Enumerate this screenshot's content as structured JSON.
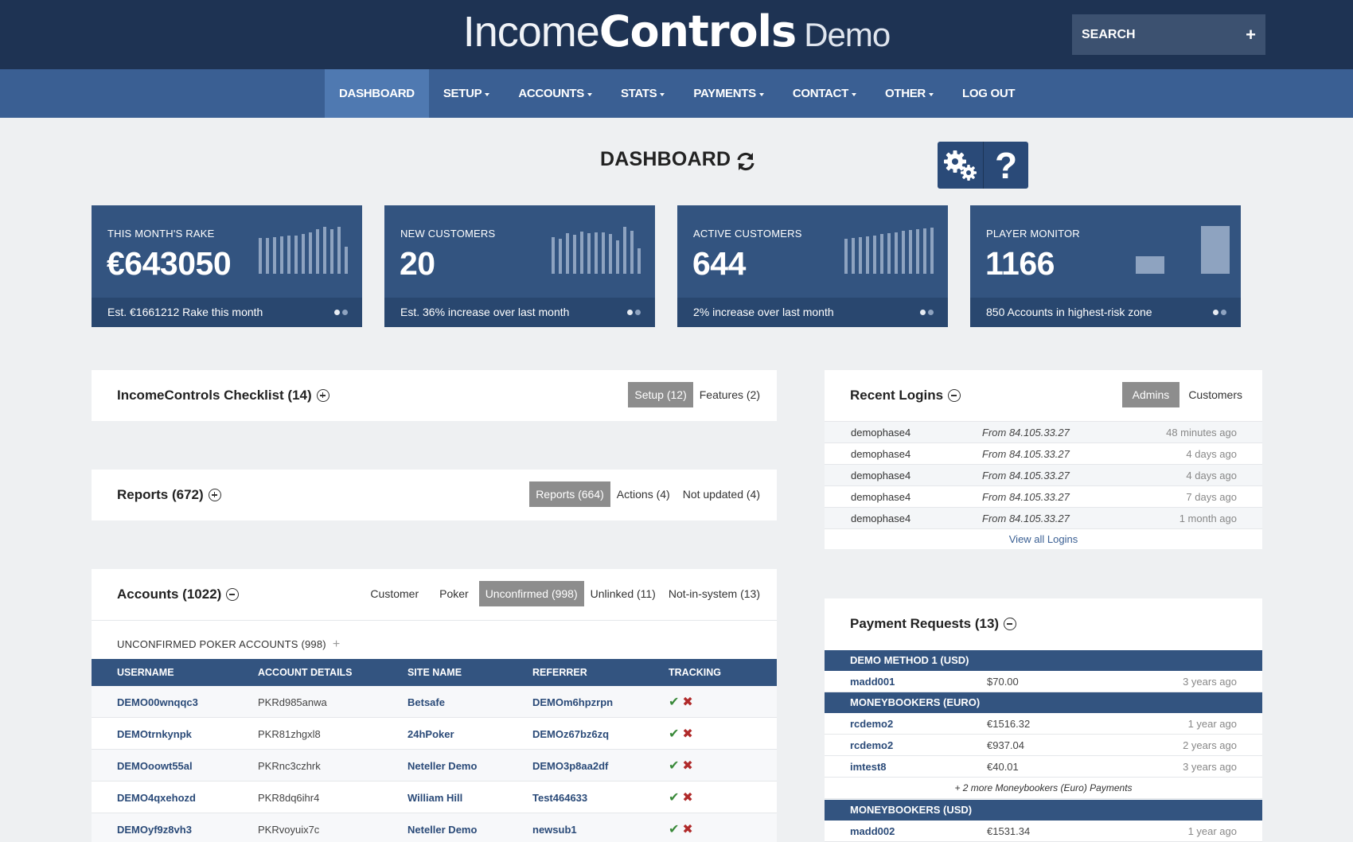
{
  "brand": {
    "part1": "Income",
    "part2": "Controls",
    "part3": "Demo"
  },
  "search": {
    "placeholder": "SEARCH",
    "plus": "+"
  },
  "nav": [
    {
      "label": "DASHBOARD",
      "active": true
    },
    {
      "label": "SETUP",
      "caret": true
    },
    {
      "label": "ACCOUNTS",
      "caret": true
    },
    {
      "label": "STATS",
      "caret": true
    },
    {
      "label": "PAYMENTS",
      "caret": true
    },
    {
      "label": "CONTACT",
      "caret": true
    },
    {
      "label": "OTHER",
      "caret": true
    },
    {
      "label": "LOG OUT"
    }
  ],
  "page": {
    "title": "DASHBOARD",
    "help": "?"
  },
  "cards": [
    {
      "title": "THIS MONTH'S RAKE",
      "value": "€643050",
      "footer": "Est. €1661212 Rake this month"
    },
    {
      "title": "NEW CUSTOMERS",
      "value": "20",
      "footer": "Est. 36% increase over last month"
    },
    {
      "title": "ACTIVE CUSTOMERS",
      "value": "644",
      "footer": "2% increase over last month"
    },
    {
      "title": "PLAYER MONITOR",
      "value": "1166",
      "footer": "850 Accounts in highest-risk zone"
    }
  ],
  "checklist": {
    "title": "IncomeControls Checklist (14)",
    "tabs": [
      "Setup (12)",
      "Features (2)"
    ]
  },
  "reports": {
    "title": "Reports (672)",
    "tabs": [
      "Reports (664)",
      "Actions (4)",
      "Not updated (4)"
    ]
  },
  "accounts": {
    "title": "Accounts (1022)",
    "tabs": [
      "Customer",
      "Poker",
      "Unconfirmed (998)",
      "Unlinked (11)",
      "Not-in-system (13)"
    ],
    "subhead": "UNCONFIRMED POKER ACCOUNTS (998)",
    "columns": [
      "USERNAME",
      "ACCOUNT DETAILS",
      "SITE NAME",
      "REFERRER",
      "TRACKING"
    ],
    "rows": [
      [
        "DEMO00wnqqc3",
        "PKRd985anwa",
        "Betsafe",
        "DEMOm6hpzrpn"
      ],
      [
        "DEMOtrnkynpk",
        "PKR81zhgxl8",
        "24hPoker",
        "DEMOz67bz6zq"
      ],
      [
        "DEMOoowt55al",
        "PKRnc3czhrk",
        "Neteller Demo",
        "DEMO3p8aa2df"
      ],
      [
        "DEMO4qxehozd",
        "PKR8dq6ihr4",
        "William Hill",
        "Test464633"
      ],
      [
        "DEMOyf9z8vh3",
        "PKRvoyuix7c",
        "Neteller Demo",
        "newsub1"
      ]
    ]
  },
  "logins": {
    "title": "Recent Logins",
    "tabs": [
      "Admins",
      "Customers"
    ],
    "rows": [
      [
        "demophase4",
        "From 84.105.33.27",
        "48 minutes ago"
      ],
      [
        "demophase4",
        "From 84.105.33.27",
        "4 days ago"
      ],
      [
        "demophase4",
        "From 84.105.33.27",
        "4 days ago"
      ],
      [
        "demophase4",
        "From 84.105.33.27",
        "7 days ago"
      ],
      [
        "demophase4",
        "From 84.105.33.27",
        "1 month ago"
      ]
    ],
    "view_all": "View all Logins"
  },
  "payments": {
    "title": "Payment Requests (13)",
    "groups": [
      {
        "name": "DEMO METHOD 1 (USD)",
        "rows": [
          [
            "madd001",
            "$70.00",
            "3 years ago"
          ]
        ]
      },
      {
        "name": "MONEYBOOKERS (EURO)",
        "rows": [
          [
            "rcdemo2",
            "€1516.32",
            "1 year ago"
          ],
          [
            "rcdemo2",
            "€937.04",
            "2 years ago"
          ],
          [
            "imtest8",
            "€40.01",
            "3 years ago"
          ]
        ],
        "more": "+ 2 more Moneybookers (Euro) Payments"
      },
      {
        "name": "MONEYBOOKERS (USD)",
        "rows": [
          [
            "madd002",
            "€1531.34",
            "1 year ago"
          ]
        ]
      }
    ]
  },
  "colors": {
    "header": "#1e3353",
    "nav": "#3a5f93",
    "card": "#335480"
  },
  "icons": [
    "refresh-icon",
    "gears-icon",
    "question-icon",
    "plus-circle-icon",
    "minus-circle-icon",
    "check-icon",
    "cross-icon"
  ]
}
